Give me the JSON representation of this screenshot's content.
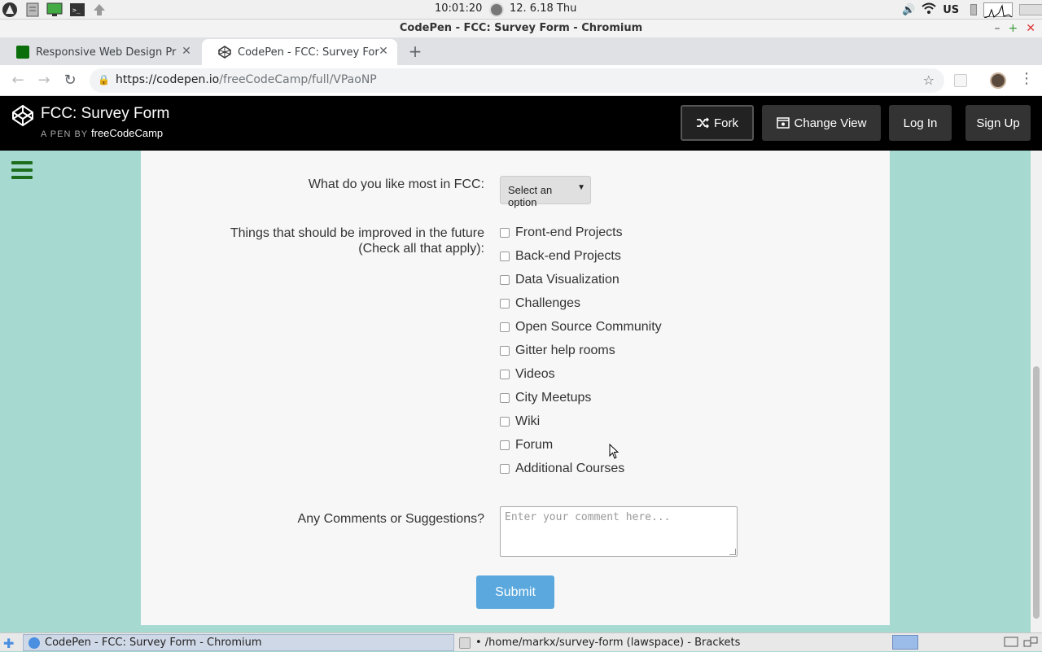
{
  "os_bar": {
    "clock": "10:01:20",
    "date": "12. 6.18 Thu",
    "keyboard_layout": "US",
    "icons": [
      "linux-logo-icon",
      "file-manager-icon",
      "system-monitor-icon",
      "terminal-icon",
      "up-arrow-icon",
      "volume-icon",
      "wifi-icon",
      "battery-icon",
      "cpu-graph-icon",
      "power-bar-icon"
    ]
  },
  "window": {
    "title": "CodePen - FCC: Survey Form - Chromium",
    "controls": [
      "minimize",
      "maximize",
      "close"
    ]
  },
  "tabs": [
    {
      "label": "Responsive Web Design Pr",
      "active": false,
      "icon": "fcc-favicon"
    },
    {
      "label": "CodePen - FCC: Survey For",
      "active": true,
      "icon": "codepen-favicon"
    }
  ],
  "address_bar": {
    "url_host": "https://codepen.io",
    "url_path": "/freeCodeCamp/full/VPaoNP"
  },
  "codepen": {
    "title": "FCC: Survey Form",
    "byline_prefix": "A PEN BY",
    "author": "freeCodeCamp",
    "buttons": {
      "fork": "Fork",
      "change_view": "Change View",
      "login": "Log In",
      "signup": "Sign Up"
    }
  },
  "form": {
    "like_label": "What do you like most in FCC:",
    "like_select_value": "Select an option",
    "improve_label_line1": "Things that should be improved in the future",
    "improve_label_line2": "(Check all that apply):",
    "options": [
      "Front-end Projects",
      "Back-end Projects",
      "Data Visualization",
      "Challenges",
      "Open Source Community",
      "Gitter help rooms",
      "Videos",
      "City Meetups",
      "Wiki",
      "Forum",
      "Additional Courses"
    ],
    "comments_label": "Any Comments or Suggestions?",
    "comments_placeholder": "Enter your comment here...",
    "submit_label": "Submit"
  },
  "taskbar": {
    "items": [
      {
        "label": "CodePen - FCC: Survey Form - Chromium",
        "active": true
      },
      {
        "label": "• /home/markx/survey-form (lawspace) - Brackets",
        "active": false
      }
    ]
  }
}
